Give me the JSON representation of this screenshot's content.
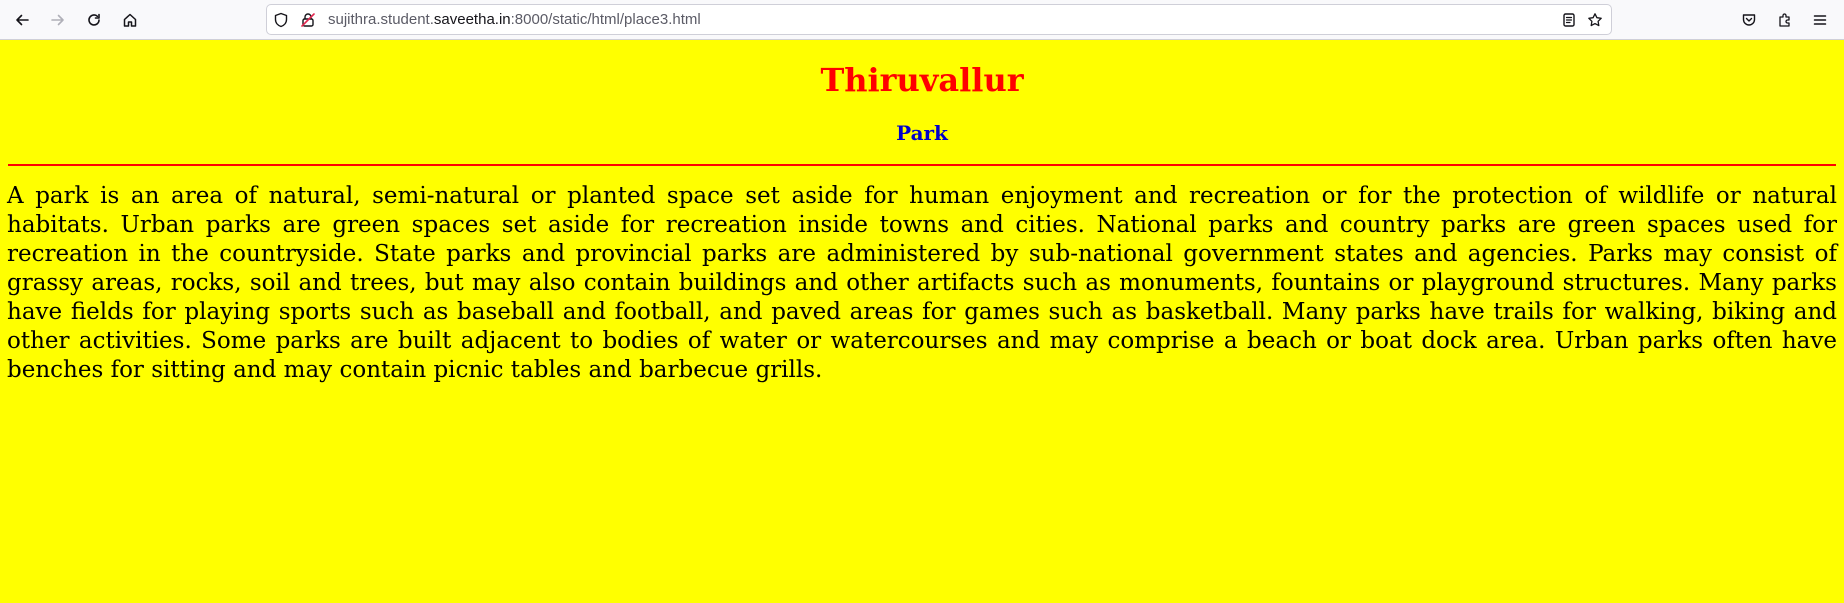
{
  "browser": {
    "url_prefix": "sujithra.student.",
    "url_domain": "saveetha.in",
    "url_suffix": ":8000/static/html/place3.html",
    "icons": {
      "back": "arrow-left-icon",
      "forward": "arrow-right-icon",
      "reload": "reload-icon",
      "home": "home-icon",
      "tracking": "shield-icon",
      "security": "insecure-lock-icon",
      "reader": "reader-view-icon",
      "bookmark": "star-icon",
      "pocket": "pocket-icon",
      "extensions": "puzzle-icon",
      "menu": "hamburger-menu-icon"
    }
  },
  "page": {
    "background": "#ffff00",
    "title": "Thiruvallur",
    "title_color": "#ff0000",
    "subtitle": "Park",
    "subtitle_color": "#0000cc",
    "divider_color": "#ff0000",
    "paragraph": "A park is an area of natural, semi-natural or planted space set aside for human enjoyment and recreation or for the protection of wildlife or natural habitats. Urban parks are green spaces set aside for recreation inside towns and cities. National parks and country parks are green spaces used for recreation in the countryside. State parks and provincial parks are administered by sub-national government states and agencies. Parks may consist of grassy areas, rocks, soil and trees, but may also contain buildings and other artifacts such as monuments, fountains or playground structures. Many parks have fields for playing sports such as baseball and football, and paved areas for games such as basketball. Many parks have trails for walking, biking and other activities. Some parks are built adjacent to bodies of water or watercourses and may comprise a beach or boat dock area. Urban parks often have benches for sitting and may contain picnic tables and barbecue grills."
  }
}
